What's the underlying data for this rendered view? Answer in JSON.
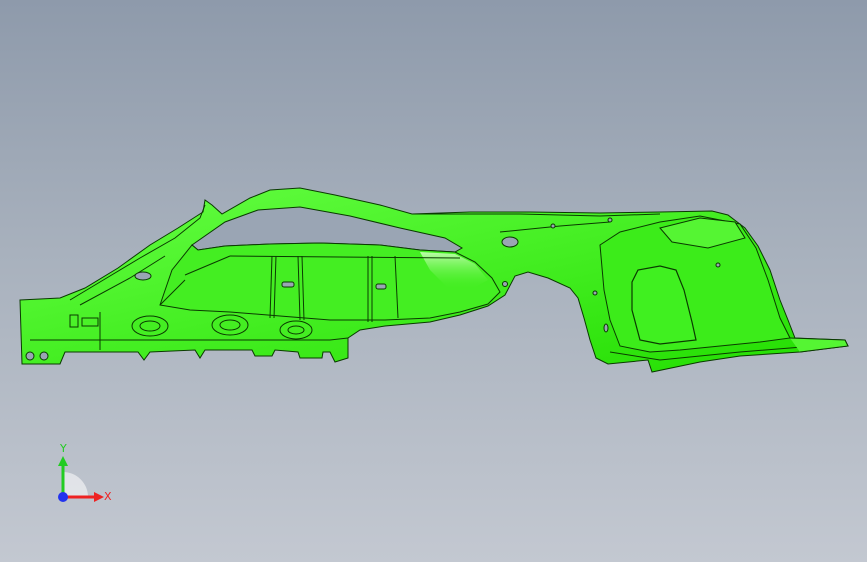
{
  "viewport": {
    "background_top": "#8e9aab",
    "background_bottom": "#c3c8d1"
  },
  "model": {
    "part_color": "#33ee11",
    "edge_color": "#0a3a00",
    "highlight_color": "#aaff88"
  },
  "triad": {
    "x_label": "X",
    "y_label": "Y",
    "x_color": "#ee2222",
    "y_color": "#22cc22",
    "z_color": "#2233ee"
  }
}
